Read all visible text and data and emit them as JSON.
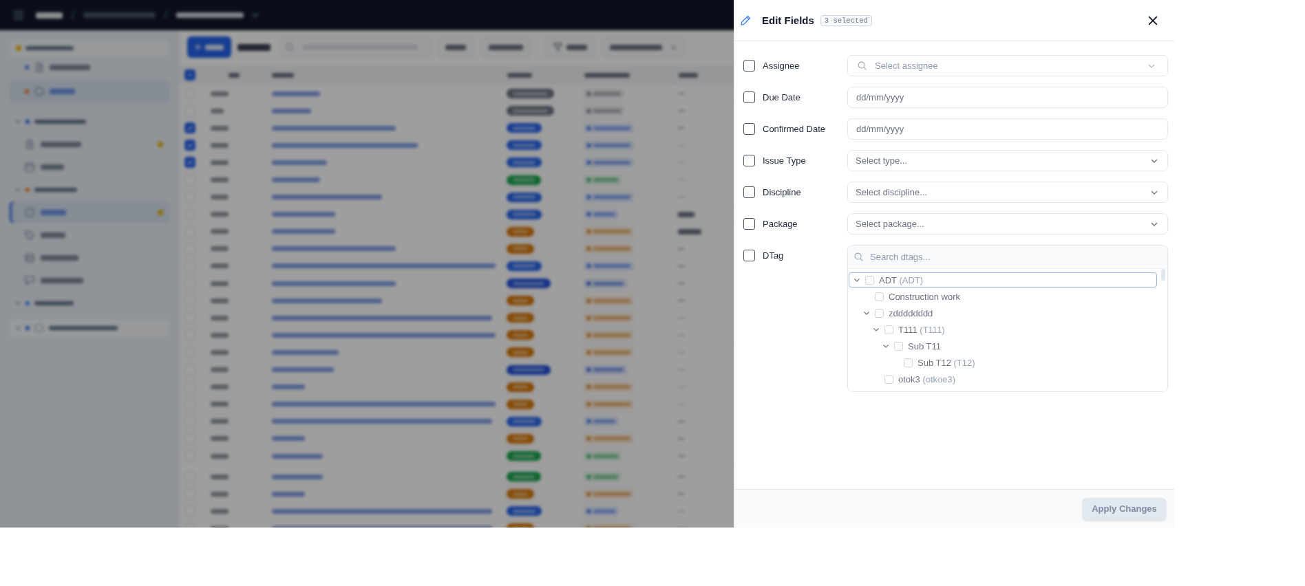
{
  "drawer": {
    "title": "Edit Fields",
    "badge": "3 selected",
    "fields": [
      {
        "label": "Assignee",
        "checked": false,
        "kind": "search-select",
        "placeholder": "Select assignee"
      },
      {
        "label": "Due Date",
        "checked": false,
        "kind": "date",
        "placeholder": "dd/mm/yyyy"
      },
      {
        "label": "Confirmed Date",
        "checked": false,
        "kind": "date",
        "placeholder": "dd/mm/yyyy"
      },
      {
        "label": "Issue Type",
        "checked": false,
        "kind": "select",
        "placeholder": "Select type..."
      },
      {
        "label": "Discipline",
        "checked": false,
        "kind": "select",
        "placeholder": "Select discipline..."
      },
      {
        "label": "Package",
        "checked": false,
        "kind": "select",
        "placeholder": "Select package..."
      },
      {
        "label": "DTag",
        "checked": false,
        "kind": "tree",
        "placeholder": "Search dtags...",
        "tree": [
          {
            "name": "ADT",
            "code": "(ADT)",
            "expanded": true,
            "checked": false,
            "selected": true,
            "children": [
              {
                "name": "Construction work",
                "checked": false,
                "selected": false
              },
              {
                "name": "zdddddddd",
                "expanded": true,
                "checked": false,
                "selected": false,
                "children": [
                  {
                    "name": "T111",
                    "code": "(T111)",
                    "expanded": true,
                    "checked": false,
                    "selected": false,
                    "children": [
                      {
                        "name": "Sub T11",
                        "expanded": true,
                        "checked": false,
                        "selected": false,
                        "children": [
                          {
                            "name": "Sub T12",
                            "code": "(T12)",
                            "checked": false,
                            "selected": false
                          }
                        ]
                      }
                    ]
                  },
                  {
                    "name": "otok3",
                    "code": "(otkoe3)",
                    "checked": false,
                    "selected": false
                  }
                ]
              }
            ]
          }
        ]
      }
    ],
    "apply_button": {
      "label": "Apply Changes",
      "disabled": true
    }
  }
}
